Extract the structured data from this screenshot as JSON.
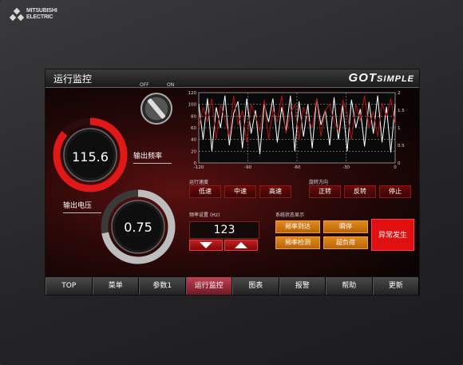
{
  "brand": {
    "line1": "MITSUBISHI",
    "line2": "ELECTRIC"
  },
  "header": {
    "title": "运行监控",
    "logo_big": "GOT",
    "logo_small": "SIMPLE"
  },
  "switch": {
    "off_label": "OFF",
    "on_label": "ON"
  },
  "gauges": {
    "frequency": {
      "label": "输出频率",
      "value": "115.6",
      "fill": 0.86,
      "color": "#e01818"
    },
    "voltage": {
      "label": "输出电压",
      "value": "0.75",
      "fill": 0.72,
      "color": "#bdbdbd"
    }
  },
  "speed": {
    "label": "运行速度",
    "buttons": [
      "低速",
      "中速",
      "高速"
    ]
  },
  "direction": {
    "label": "旋转方向",
    "buttons": [
      "正转",
      "反转",
      "停止"
    ]
  },
  "freq_setting": {
    "label": "频率设置",
    "unit": "(Hz)",
    "value": "123"
  },
  "status": {
    "label": "系统状态显示",
    "items": [
      "频率到达",
      "瞬停",
      "频率检测",
      "超负荷"
    ]
  },
  "alarm": {
    "label": "异常发生"
  },
  "nav": {
    "items": [
      "TOP",
      "菜单",
      "参数1",
      "运行监控",
      "图表",
      "报警",
      "帮助",
      "更新"
    ],
    "active_index": 3
  },
  "chart_data": {
    "type": "line",
    "x_ticks": [
      "-120",
      "-90",
      "-60",
      "-30",
      "0"
    ],
    "xlim": [
      -120,
      0
    ],
    "y_left_ticks": [
      "120",
      "100",
      "80",
      "60",
      "40",
      "20",
      "0"
    ],
    "y_left_lim": [
      0,
      120
    ],
    "y_right_ticks": [
      "2",
      "1.5",
      "1",
      "0.5",
      "0"
    ],
    "y_right_lim": [
      0,
      2
    ],
    "grid": true,
    "series": [
      {
        "color": "#ffffff",
        "axis": "left",
        "values": [
          100,
          40,
          110,
          20,
          95,
          60,
          115,
          30,
          85,
          105,
          25,
          110,
          50,
          90,
          15,
          100,
          70,
          110,
          35,
          95,
          55,
          115,
          20,
          105,
          45,
          100,
          25,
          110,
          65,
          90,
          30,
          112,
          40,
          98,
          20,
          108,
          60,
          92,
          28,
          104,
          50,
          115,
          35,
          96,
          18,
          100
        ]
      },
      {
        "color": "#b81010",
        "axis": "left",
        "values": [
          60,
          95,
          70,
          110,
          40,
          100,
          75,
          45,
          115,
          65,
          90,
          35,
          100,
          80,
          55,
          108,
          40,
          92,
          70,
          115,
          50,
          85,
          100,
          40,
          95,
          75,
          60,
          110,
          45,
          90,
          100,
          70,
          55,
          108,
          85,
          40,
          100,
          72,
          115,
          60,
          88,
          45,
          102,
          78,
          110,
          65
        ]
      }
    ]
  }
}
